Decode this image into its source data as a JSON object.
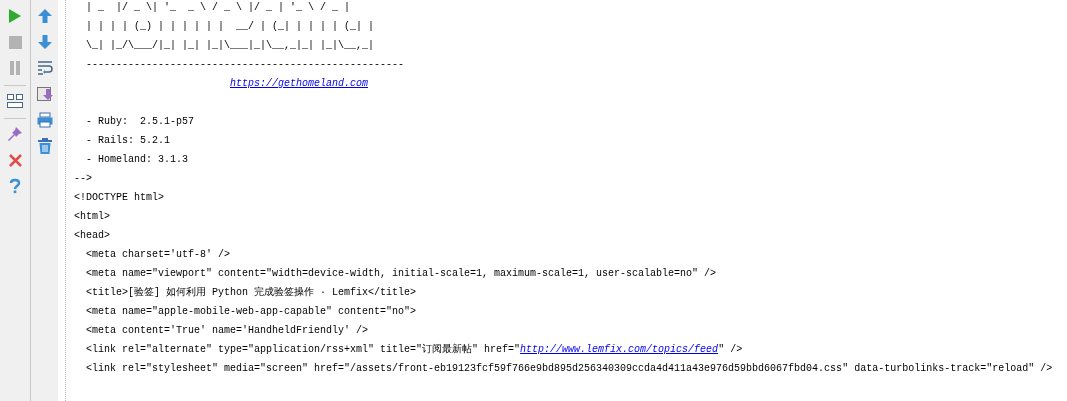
{
  "toolbar_left": [
    {
      "kind": "run",
      "disabled": false
    },
    {
      "kind": "stop",
      "disabled": true
    },
    {
      "kind": "pause",
      "disabled": true
    },
    {
      "kind": "separator"
    },
    {
      "kind": "layout",
      "disabled": false
    },
    {
      "kind": "separator"
    },
    {
      "kind": "pin",
      "disabled": false
    },
    {
      "kind": "close",
      "disabled": false
    },
    {
      "kind": "help",
      "disabled": false
    }
  ],
  "toolbar_right": [
    {
      "kind": "up"
    },
    {
      "kind": "down"
    },
    {
      "kind": "wrap"
    },
    {
      "kind": "scroll-end"
    },
    {
      "kind": "print"
    },
    {
      "kind": "trash"
    }
  ],
  "console_lines": [
    {
      "parts": [
        {
          "kind": "text",
          "text": "  | _  |/ _ \\| '_  _ \\ / _ \\ |/ _ | '_ \\ / _ |"
        }
      ]
    },
    {
      "parts": [
        {
          "kind": "text",
          "text": "  | | | | (_) | | | | | |  __/ | (_| | | | | (_| |"
        }
      ]
    },
    {
      "parts": [
        {
          "kind": "text",
          "text": "  \\_| |_/\\___/|_| |_| |_|\\___|_|\\__,_|_| |_|\\__,_|"
        }
      ]
    },
    {
      "parts": [
        {
          "kind": "text",
          "text": "  -----------------------------------------------------"
        }
      ]
    },
    {
      "parts": [
        {
          "kind": "link",
          "text": "https://gethomeland.com"
        }
      ]
    },
    {
      "blank_line_before": true,
      "parts": [
        {
          "kind": "text",
          "text": "  - Ruby:  2.5.1-p57"
        }
      ]
    },
    {
      "parts": [
        {
          "kind": "text",
          "text": "  - Rails: 5.2.1"
        }
      ]
    },
    {
      "parts": [
        {
          "kind": "text",
          "text": "  - Homeland: 3.1.3"
        }
      ]
    },
    {
      "parts": [
        {
          "kind": "text",
          "text": "-->"
        }
      ]
    },
    {
      "parts": [
        {
          "kind": "text",
          "text": "<!DOCTYPE html>"
        }
      ]
    },
    {
      "parts": [
        {
          "kind": "text",
          "text": "<html>"
        }
      ]
    },
    {
      "parts": [
        {
          "kind": "text",
          "text": "<head>"
        }
      ]
    },
    {
      "parts": [
        {
          "kind": "text",
          "text": "  <meta charset='utf-8' />"
        }
      ]
    },
    {
      "parts": [
        {
          "kind": "text",
          "text": "  <meta name=\"viewport\" content=\"width=device-width, initial-scale=1, maximum-scale=1, user-scalable=no\" />"
        }
      ]
    },
    {
      "parts": [
        {
          "kind": "text",
          "text": "  <title>[验签] 如何利用 Python 完成验签操作 · Lemfix</title>"
        }
      ]
    },
    {
      "parts": [
        {
          "kind": "text",
          "text": "  <meta name=\"apple-mobile-web-app-capable\" content=\"no\">"
        }
      ]
    },
    {
      "parts": [
        {
          "kind": "text",
          "text": "  <meta content='True' name='HandheldFriendly' />"
        }
      ]
    },
    {
      "parts": [
        {
          "kind": "text",
          "text": "  <link rel=\"alternate\" type=\"application/rss+xml\" title=\"订阅最新帖\" href=\""
        },
        {
          "kind": "link",
          "text": "http://www.lemfix.com/topics/feed"
        },
        {
          "kind": "text",
          "text": "\" />"
        }
      ]
    },
    {
      "parts": [
        {
          "kind": "text",
          "text": "  <link rel=\"stylesheet\" media=\"screen\" href=\"/assets/front-eb19123fcf59f766e9bd895d256340309ccda4d411a43e976d59bbd6067fbd04.css\" data-turbolinks-track=\"reload\" />"
        }
      ]
    }
  ]
}
